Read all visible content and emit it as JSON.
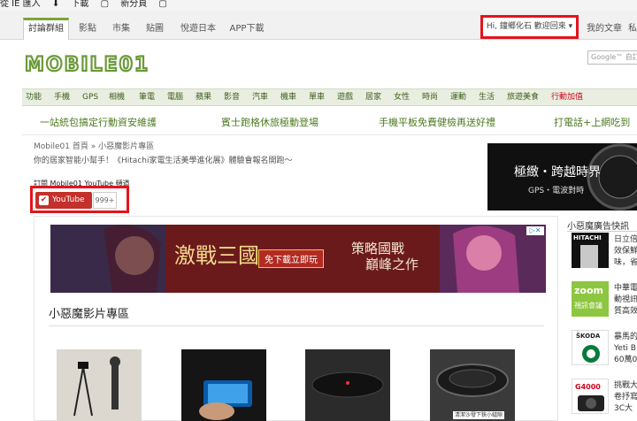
{
  "browser": {
    "items": [
      "從 IE 匯入",
      "下載",
      "新分頁"
    ]
  },
  "topnav": {
    "tabs": [
      "討論群組",
      "影點",
      "市集",
      "贴圖",
      "悅遊日本",
      "APP下載"
    ],
    "greeting": "Hi, 鐘鄉化石 歡迎回來 ▾",
    "my_articles": "我的文章",
    "private_short": "私"
  },
  "header": {
    "logo_text": "MOBILE01",
    "search_placeholder": "Google™ 自訂"
  },
  "categories": [
    "功能",
    "手機",
    "GPS",
    "相機",
    "筆電",
    "電腦",
    "蘋果",
    "影音",
    "汽車",
    "機車",
    "單車",
    "遊戲",
    "居家",
    "女性",
    "時尚",
    "運動",
    "生活",
    "旅遊美食",
    "行動加值"
  ],
  "promos": [
    "一站統包搞定行動資安維護",
    "賓士跑格休旅極動登場",
    "手機平板免費健檢再送好禮",
    "打電話+上網吃到"
  ],
  "breadcrumb": "Mobile01 首頁 » 小惡魔影片專區",
  "subtitle": "你的居家智能小幫手！《Hitachi家電生活美學進化展》體驗會報名開跑～",
  "youtube": {
    "channel_label": "訂閱 Mobile01 YouTube 頻道",
    "button": "YouTube",
    "count": "999+"
  },
  "right_ad": {
    "title": "極緻・跨越時界",
    "subtitle": "GPS・電波對時"
  },
  "banner": {
    "game_title": "激戰三國",
    "button": "免下載立即玩",
    "slogan_1": "策略國戰",
    "slogan_2": "巔峰之作",
    "ad_mark": "▷✕"
  },
  "section_title": "小惡魔影片專區",
  "thumbnails": [
    {
      "caption": ""
    },
    {
      "caption": ""
    },
    {
      "caption": ""
    },
    {
      "caption": "清潔沙發下狹小縫隙"
    }
  ],
  "sidebar": {
    "heading": "小惡魔廣告快訊",
    "items": [
      {
        "brand": "HITACHI",
        "lines": [
          "日立倍",
          "效保鮮",
          "味，省"
        ]
      },
      {
        "brand": "zoom",
        "brand_sub": "視訊會議",
        "lines": [
          "中華電",
          "動視訊",
          "質高效"
        ]
      },
      {
        "brand": "ŠKODA",
        "lines": [
          "暴馬的",
          "Yeti B",
          "60萬0"
        ]
      },
      {
        "brand": "G4000",
        "lines": [
          "挑戰大",
          "卷抒寫",
          "3C大"
        ]
      }
    ]
  },
  "colors": {
    "green": "#7aa53c",
    "red_outline": "#e3141b",
    "youtube_red": "#c4302b"
  }
}
